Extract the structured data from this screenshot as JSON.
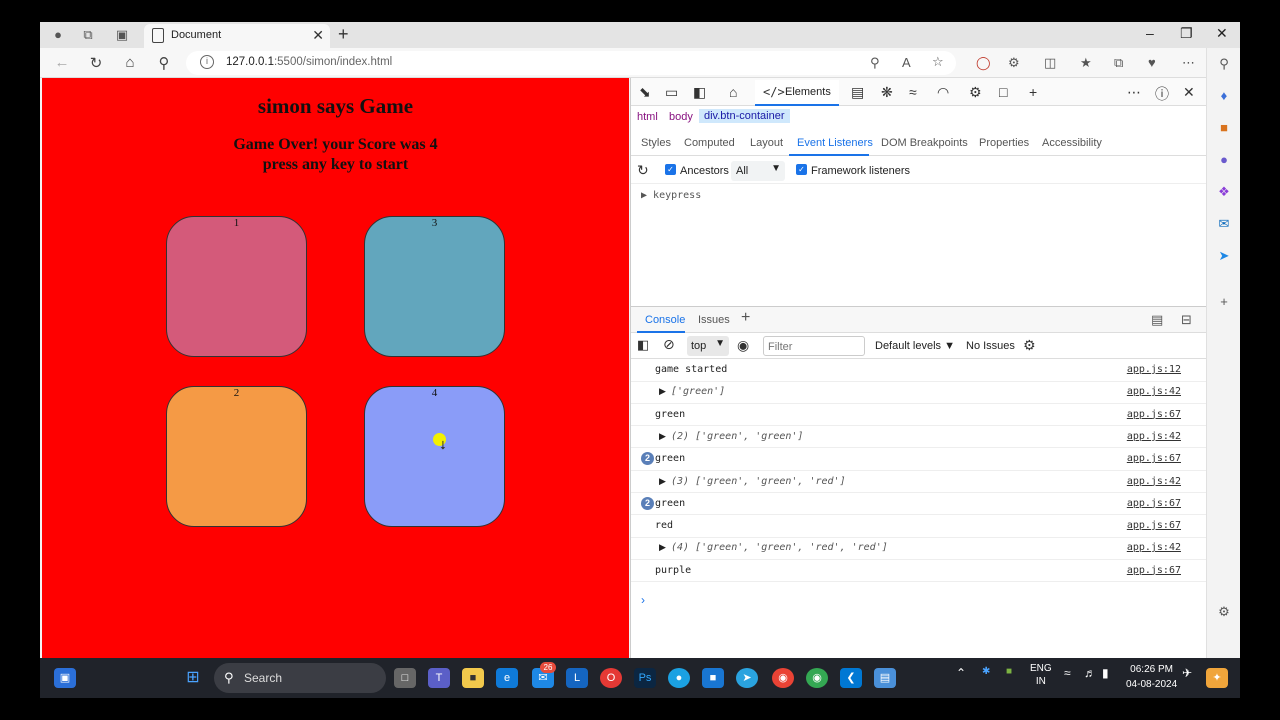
{
  "browser": {
    "tab_title": "Document",
    "url_host": "127.0.0.1",
    "url_path": ":5500/simon/index.html"
  },
  "page": {
    "heading": "simon says Game",
    "status_line1": "Game Over! your Score was 4",
    "status_line2": "press any key to start",
    "buttons": [
      {
        "label": "1",
        "color": "#d45a7a"
      },
      {
        "label": "3",
        "color": "#62a6bd"
      },
      {
        "label": "2",
        "color": "#f59a45"
      },
      {
        "label": "4",
        "color": "#8a9cf8"
      }
    ]
  },
  "devtools": {
    "main_tab": "Elements",
    "breadcrumbs": [
      "html",
      "body",
      "div.btn-container"
    ],
    "subtabs": [
      "Styles",
      "Computed",
      "Layout",
      "Event Listeners",
      "DOM Breakpoints",
      "Properties",
      "Accessibility"
    ],
    "ancestors_label": "Ancestors",
    "filter_select": "All",
    "framework_label": "Framework listeners",
    "listener": "keypress",
    "drawer_tabs": [
      "Console",
      "Issues"
    ],
    "context": "top",
    "filter_placeholder": "Filter",
    "levels": "Default levels",
    "no_issues": "No Issues",
    "logs": [
      {
        "text": "game started",
        "src": "app.js:12",
        "kind": "text",
        "count": ""
      },
      {
        "text": "['green']",
        "src": "app.js:42",
        "kind": "obj",
        "count": ""
      },
      {
        "text": "green",
        "src": "app.js:67",
        "kind": "text",
        "count": ""
      },
      {
        "text": "(2) ['green', 'green']",
        "src": "app.js:42",
        "kind": "obj",
        "count": ""
      },
      {
        "text": "green",
        "src": "app.js:67",
        "kind": "text",
        "count": "2"
      },
      {
        "text": "(3) ['green', 'green', 'red']",
        "src": "app.js:42",
        "kind": "obj",
        "count": ""
      },
      {
        "text": "green",
        "src": "app.js:67",
        "kind": "text",
        "count": "2"
      },
      {
        "text": "red",
        "src": "app.js:67",
        "kind": "text",
        "count": ""
      },
      {
        "text": "(4) ['green', 'green', 'red', 'red']",
        "src": "app.js:42",
        "kind": "obj",
        "count": ""
      },
      {
        "text": "purple",
        "src": "app.js:67",
        "kind": "text",
        "count": ""
      }
    ]
  },
  "taskbar": {
    "search_label": "Search",
    "mail_badge": "26",
    "lang_line1": "ENG",
    "lang_line2": "IN",
    "time": "06:26 PM",
    "date": "04-08-2024"
  }
}
